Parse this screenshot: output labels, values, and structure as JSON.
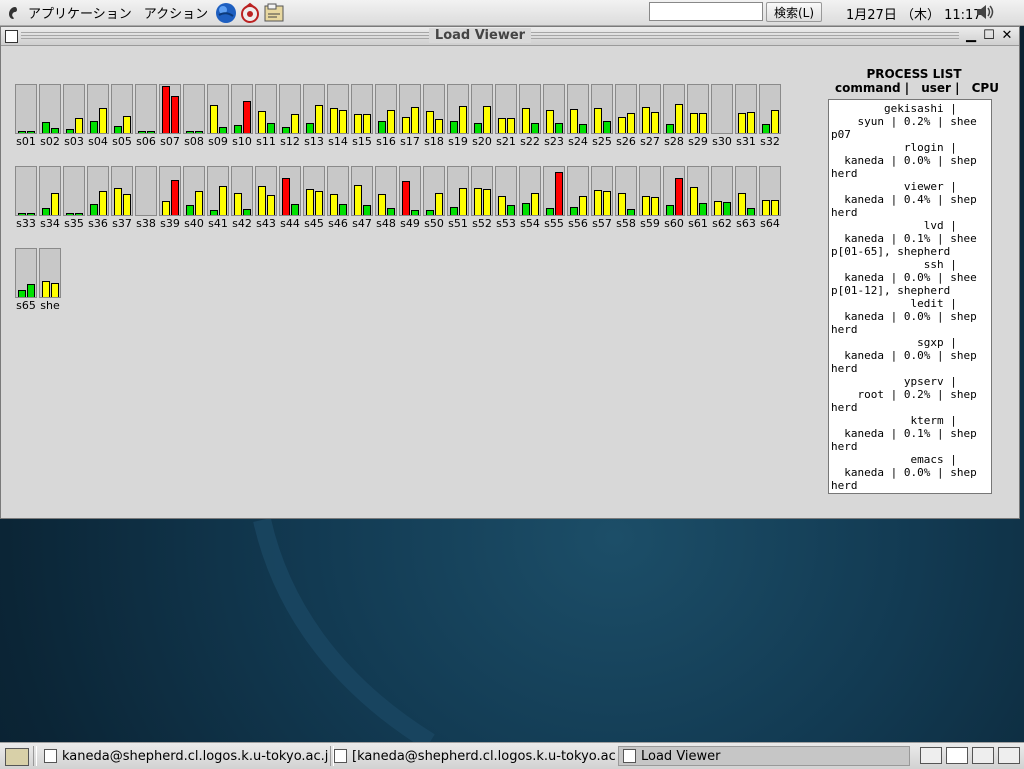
{
  "top_panel": {
    "applications_label": "アプリケーション",
    "actions_label": "アクション",
    "launchers": [
      "web-browser-icon",
      "mail-client-icon",
      "file-manager-icon"
    ],
    "search_placeholder": "",
    "search_button_label": "検索(L)",
    "clock": "1月27日 （木） 11:17"
  },
  "window": {
    "title": "Load Viewer",
    "process_list": {
      "header": "PROCESS LIST",
      "columns": [
        "command |",
        "user |",
        "CPU"
      ],
      "lines": [
        "        gekisashi |",
        "    syun | 0.2% | shee",
        "p07",
        "           rlogin |",
        "  kaneda | 0.0% | shep",
        "herd",
        "           viewer |",
        "  kaneda | 0.4% | shep",
        "herd",
        "              lvd |",
        "  kaneda | 0.1% | shee",
        "p[01-65], shepherd",
        "              ssh |",
        "  kaneda | 0.0% | shee",
        "p[01-12], shepherd",
        "            ledit |",
        "  kaneda | 0.0% | shep",
        "herd",
        "             sgxp |",
        "  kaneda | 0.0% | shep",
        "herd",
        "           ypserv |",
        "    root | 0.2% | shep",
        "herd",
        "            kterm |",
        "  kaneda | 0.1% | shep",
        "herd",
        "            emacs |",
        "  kaneda | 0.0% | shep",
        "herd"
      ]
    },
    "colors": {
      "low": "#00e000",
      "mid": "#ffff00",
      "high": "#ff0000",
      "empty": "#c8c8c8"
    },
    "hosts": [
      {
        "name": "s01",
        "a": 0.04,
        "b": 0.02
      },
      {
        "name": "s02",
        "a": 0.22,
        "b": 0.1
      },
      {
        "name": "s03",
        "a": 0.08,
        "b": 0.32
      },
      {
        "name": "s04",
        "a": 0.24,
        "b": 0.52
      },
      {
        "name": "s05",
        "a": 0.14,
        "b": 0.36
      },
      {
        "name": "s06",
        "a": 0.03,
        "b": 0.03
      },
      {
        "name": "s07",
        "a": 0.98,
        "b": 0.78
      },
      {
        "name": "s08",
        "a": 0.02,
        "b": 0.03
      },
      {
        "name": "s09",
        "a": 0.58,
        "b": 0.12
      },
      {
        "name": "s10",
        "a": 0.16,
        "b": 0.66
      },
      {
        "name": "s11",
        "a": 0.46,
        "b": 0.2
      },
      {
        "name": "s12",
        "a": 0.12,
        "b": 0.4
      },
      {
        "name": "s13",
        "a": 0.2,
        "b": 0.58
      },
      {
        "name": "s14",
        "a": 0.52,
        "b": 0.48
      },
      {
        "name": "s15",
        "a": 0.4,
        "b": 0.4
      },
      {
        "name": "s16",
        "a": 0.24,
        "b": 0.48
      },
      {
        "name": "s17",
        "a": 0.34,
        "b": 0.54
      },
      {
        "name": "s18",
        "a": 0.46,
        "b": 0.3
      },
      {
        "name": "s19",
        "a": 0.24,
        "b": 0.56
      },
      {
        "name": "s20",
        "a": 0.2,
        "b": 0.56
      },
      {
        "name": "s21",
        "a": 0.32,
        "b": 0.32
      },
      {
        "name": "s22",
        "a": 0.52,
        "b": 0.2
      },
      {
        "name": "s23",
        "a": 0.48,
        "b": 0.2
      },
      {
        "name": "s24",
        "a": 0.5,
        "b": 0.18
      },
      {
        "name": "s25",
        "a": 0.52,
        "b": 0.26
      },
      {
        "name": "s26",
        "a": 0.34,
        "b": 0.42
      },
      {
        "name": "s27",
        "a": 0.54,
        "b": 0.44
      },
      {
        "name": "s28",
        "a": 0.18,
        "b": 0.6
      },
      {
        "name": "s29",
        "a": 0.42,
        "b": 0.42
      },
      {
        "name": "s30",
        "a": 0.0,
        "b": 0.0
      },
      {
        "name": "s31",
        "a": 0.42,
        "b": 0.44
      },
      {
        "name": "s32",
        "a": 0.18,
        "b": 0.48
      },
      {
        "name": "s33",
        "a": 0.04,
        "b": 0.02
      },
      {
        "name": "s34",
        "a": 0.14,
        "b": 0.46
      },
      {
        "name": "s35",
        "a": 0.03,
        "b": 0.02
      },
      {
        "name": "s36",
        "a": 0.22,
        "b": 0.5
      },
      {
        "name": "s37",
        "a": 0.56,
        "b": 0.44
      },
      {
        "name": "s38",
        "a": 0.0,
        "b": 0.0
      },
      {
        "name": "s39",
        "a": 0.3,
        "b": 0.72
      },
      {
        "name": "s40",
        "a": 0.2,
        "b": 0.5
      },
      {
        "name": "s41",
        "a": 0.1,
        "b": 0.6
      },
      {
        "name": "s42",
        "a": 0.46,
        "b": 0.12
      },
      {
        "name": "s43",
        "a": 0.6,
        "b": 0.42
      },
      {
        "name": "s44",
        "a": 0.78,
        "b": 0.22
      },
      {
        "name": "s45",
        "a": 0.54,
        "b": 0.5
      },
      {
        "name": "s46",
        "a": 0.44,
        "b": 0.22
      },
      {
        "name": "s47",
        "a": 0.62,
        "b": 0.2
      },
      {
        "name": "s48",
        "a": 0.44,
        "b": 0.14
      },
      {
        "name": "s49",
        "a": 0.7,
        "b": 0.1
      },
      {
        "name": "s50",
        "a": 0.1,
        "b": 0.46
      },
      {
        "name": "s51",
        "a": 0.16,
        "b": 0.56
      },
      {
        "name": "s52",
        "a": 0.56,
        "b": 0.54
      },
      {
        "name": "s53",
        "a": 0.4,
        "b": 0.2
      },
      {
        "name": "s54",
        "a": 0.24,
        "b": 0.46
      },
      {
        "name": "s55",
        "a": 0.14,
        "b": 0.9
      },
      {
        "name": "s56",
        "a": 0.16,
        "b": 0.4
      },
      {
        "name": "s57",
        "a": 0.52,
        "b": 0.5
      },
      {
        "name": "s58",
        "a": 0.46,
        "b": 0.12
      },
      {
        "name": "s59",
        "a": 0.4,
        "b": 0.38
      },
      {
        "name": "s60",
        "a": 0.2,
        "b": 0.78
      },
      {
        "name": "s61",
        "a": 0.58,
        "b": 0.24
      },
      {
        "name": "s62",
        "a": 0.3,
        "b": 0.28
      },
      {
        "name": "s63",
        "a": 0.46,
        "b": 0.14
      },
      {
        "name": "s64",
        "a": 0.32,
        "b": 0.32
      },
      {
        "name": "s65",
        "a": 0.14,
        "b": 0.28
      },
      {
        "name": "she",
        "a": 0.34,
        "b": 0.3
      }
    ]
  },
  "taskbar": {
    "tasks": [
      "kaneda@shepherd.cl.logos.k.u-tokyo.ac.jp",
      "[kaneda@shepherd.cl.logos.k.u-tokyo.ac.jp",
      "Load Viewer"
    ]
  }
}
